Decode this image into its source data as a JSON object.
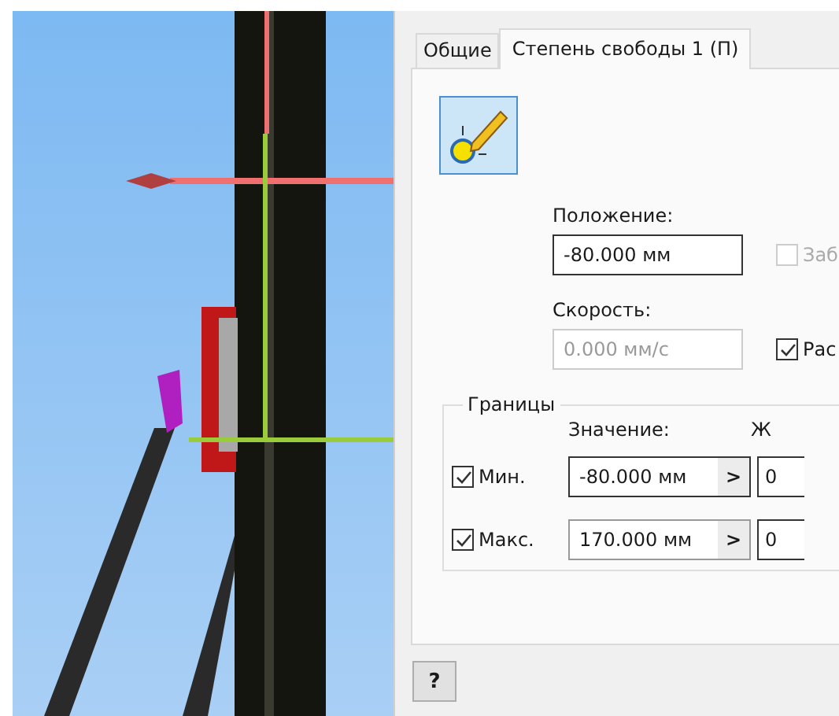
{
  "tabs": [
    {
      "label": "Общие",
      "selected": false
    },
    {
      "label": "Степень свободы 1 (П)",
      "selected": true
    }
  ],
  "position": {
    "label": "Положение:",
    "value": "-80.000 мм"
  },
  "lock_checkbox": {
    "label": "Заб",
    "checked": false,
    "disabled": true
  },
  "speed": {
    "label": "Скорость:",
    "value": "0.000 мм/с",
    "disabled": true
  },
  "second_checkbox": {
    "label": "Рас",
    "checked": true,
    "disabled": false
  },
  "limits": {
    "title": "Границы",
    "value_header": "Значение:",
    "column_3_header": "Ж",
    "rows": [
      {
        "label": "Мин.",
        "checked": true,
        "value": "-80.000 мм",
        "button": ">",
        "column_3": "0"
      },
      {
        "label": "Макс.",
        "checked": true,
        "value": "170.000 мм",
        "button": ">",
        "column_3": "0"
      }
    ]
  },
  "help_button": "?"
}
